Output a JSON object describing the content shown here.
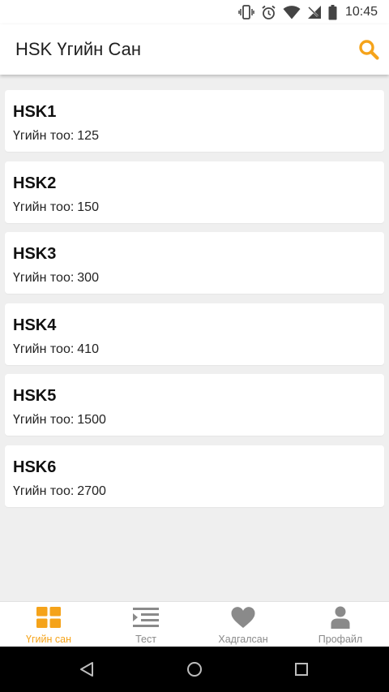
{
  "status_bar": {
    "time": "10:45",
    "icons": [
      "vibrate-icon",
      "alarm-icon",
      "wifi-icon",
      "signal-off-icon",
      "battery-icon"
    ]
  },
  "app_bar": {
    "title": "HSK Үгийн Сан",
    "search_icon": "search-icon"
  },
  "list": {
    "count_label": "Үгийн тоо:",
    "items": [
      {
        "title": "HSK1",
        "count": "125"
      },
      {
        "title": "HSK2",
        "count": "150"
      },
      {
        "title": "HSK3",
        "count": "300"
      },
      {
        "title": "HSK4",
        "count": "410"
      },
      {
        "title": "HSK5",
        "count": "1500"
      },
      {
        "title": "HSK6",
        "count": "2700"
      }
    ]
  },
  "bottom_nav": {
    "active_index": 0,
    "items": [
      {
        "label": "Үгийн сан",
        "icon": "grid-icon"
      },
      {
        "label": "Тест",
        "icon": "list-icon"
      },
      {
        "label": "Хадгалсан",
        "icon": "heart-icon"
      },
      {
        "label": "Профайл",
        "icon": "person-icon"
      }
    ]
  },
  "system_nav": [
    "back-icon",
    "home-icon",
    "recents-icon"
  ],
  "colors": {
    "accent": "#f5a31a",
    "inactive": "#8a8a8a",
    "background": "#efefef",
    "card": "#ffffff"
  }
}
